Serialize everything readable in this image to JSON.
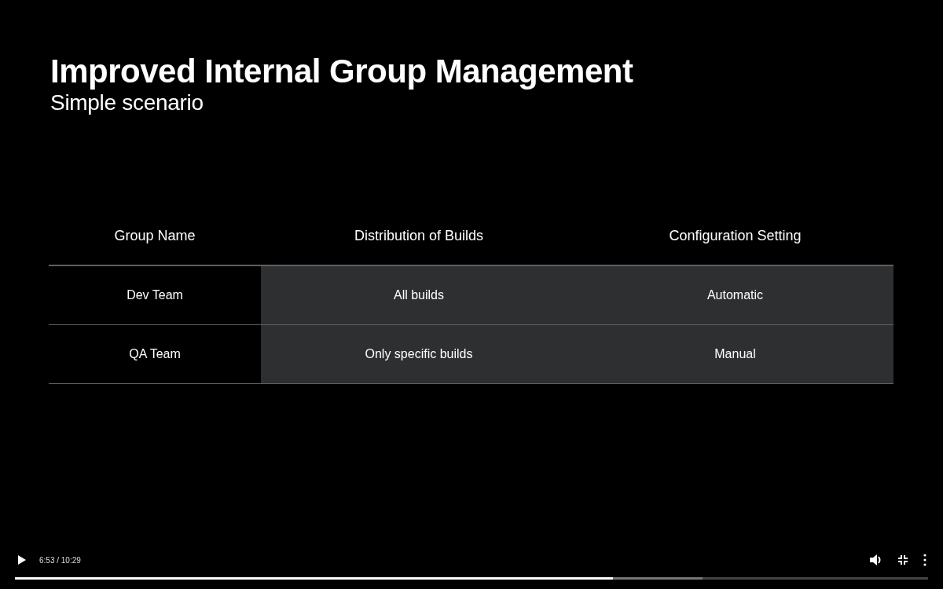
{
  "slide": {
    "title": "Improved Internal Group Management",
    "subtitle": "Simple scenario",
    "table": {
      "columns": [
        {
          "label": "Group Name",
          "highlighted": false
        },
        {
          "label": "Distribution of Builds",
          "highlighted": true
        },
        {
          "label": "Configuration Setting",
          "highlighted": true
        }
      ],
      "rows": [
        [
          "Dev Team",
          "All builds",
          "Automatic"
        ],
        [
          "QA Team",
          "Only specific builds",
          "Manual"
        ]
      ]
    }
  },
  "player": {
    "playing": false,
    "time": "6:53 / 10:29",
    "progress": {
      "level": 0.655
    },
    "buffer": {
      "level": 0.753
    },
    "fullscreen": true
  }
}
